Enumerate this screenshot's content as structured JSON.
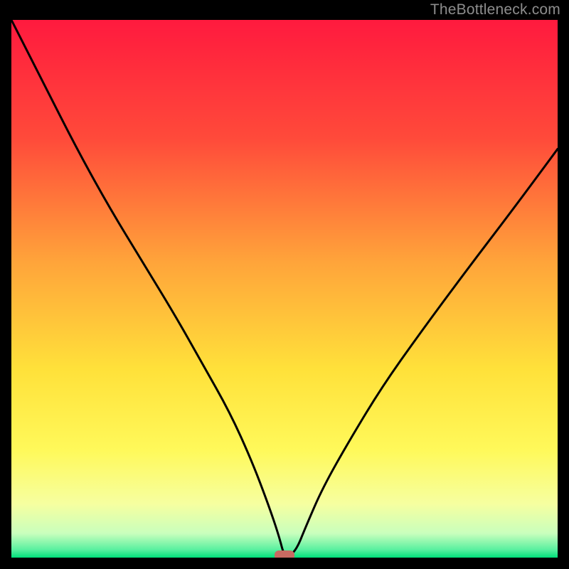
{
  "watermark": "TheBottleneck.com",
  "chart_data": {
    "type": "line",
    "title": "",
    "xlabel": "",
    "ylabel": "",
    "xlim": [
      0,
      100
    ],
    "ylim": [
      0,
      100
    ],
    "grid": false,
    "legend": false,
    "x": [
      0,
      6,
      12,
      18,
      24,
      30,
      35,
      40,
      44,
      47,
      49,
      50,
      52,
      54,
      57,
      62,
      68,
      75,
      83,
      92,
      100
    ],
    "values": [
      100,
      88,
      76,
      65,
      55,
      45,
      36,
      27,
      18,
      10,
      4,
      0,
      1,
      6,
      13,
      22,
      32,
      42,
      53,
      65,
      76
    ],
    "minimum_marker": {
      "x": 50,
      "y": 0
    },
    "background_gradient": {
      "stops": [
        {
          "offset": 0.0,
          "color": "#ff1a3e"
        },
        {
          "offset": 0.22,
          "color": "#ff4a3a"
        },
        {
          "offset": 0.45,
          "color": "#ffa43a"
        },
        {
          "offset": 0.65,
          "color": "#ffe13a"
        },
        {
          "offset": 0.8,
          "color": "#fff95a"
        },
        {
          "offset": 0.9,
          "color": "#f6ffa0"
        },
        {
          "offset": 0.955,
          "color": "#c9ffbd"
        },
        {
          "offset": 0.985,
          "color": "#5af0a0"
        },
        {
          "offset": 1.0,
          "color": "#00e07a"
        }
      ]
    }
  }
}
